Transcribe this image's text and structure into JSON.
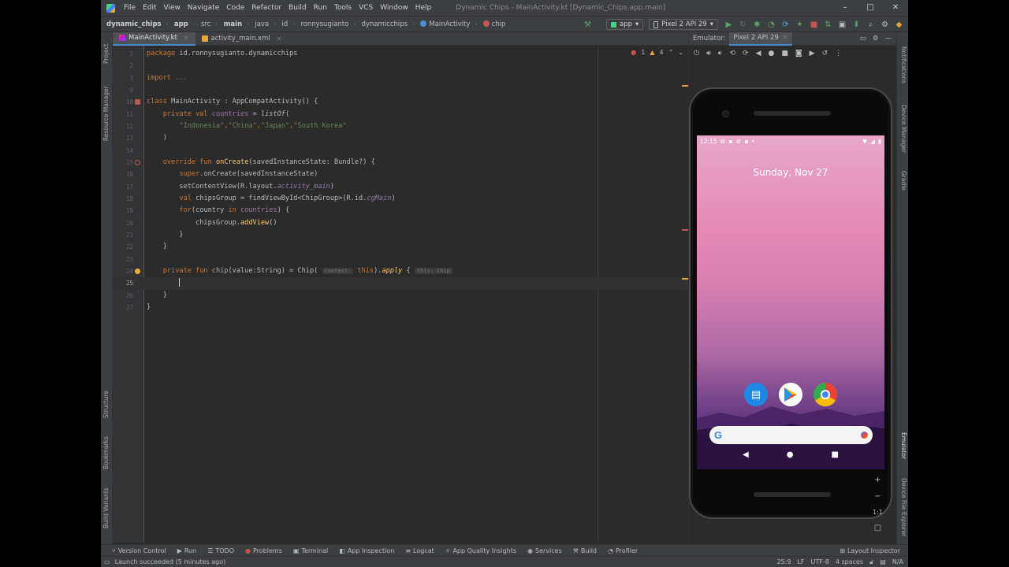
{
  "menubar": {
    "items": [
      "File",
      "Edit",
      "View",
      "Navigate",
      "Code",
      "Refactor",
      "Build",
      "Run",
      "Tools",
      "VCS",
      "Window",
      "Help"
    ],
    "window_title": "Dynamic Chips - MainActivity.kt [Dynamic_Chips.app.main]",
    "minimize": "–",
    "maximize": "□",
    "close": "✕"
  },
  "breadcrumbs": [
    "dynamic_chips",
    "app",
    "src",
    "main",
    "java",
    "id",
    "ronnysugianto",
    "dynamicchips",
    "MainActivity",
    "chip"
  ],
  "toolbar": {
    "config": "app",
    "device": "Pixel 2 API 29"
  },
  "left_tools": [
    "Project",
    "Resource Manager",
    "Structure",
    "Bookmarks",
    "Build Variants"
  ],
  "right_tools": [
    "Notifications",
    "Device Manager",
    "Gradle",
    "Emulator",
    "Device File Explorer"
  ],
  "tabs": [
    {
      "label": "MainActivity.kt",
      "active": true
    },
    {
      "label": "activity_main.xml",
      "active": false
    }
  ],
  "inspection": {
    "errors": "1",
    "warnings": "4"
  },
  "code": {
    "l1": {
      "num": "1",
      "kw": "package",
      "rest": " id.ronnysugianto.dynamicchips"
    },
    "l2": {
      "num": "2"
    },
    "l3": {
      "num": "3",
      "kw": "import",
      "rest": " ..."
    },
    "l9": {
      "num": "9"
    },
    "l10": {
      "num": "10",
      "kw": "class",
      "name": " MainActivity",
      "rest": " : AppCompatActivity() {"
    },
    "l11": {
      "num": "11",
      "kw": "    private val",
      "prop": " countries",
      "rest": " = ",
      "fn": "listOf",
      "rest2": "("
    },
    "l12": {
      "num": "12",
      "s1": "\"Indonesia\"",
      "c1": ",",
      "s2": "\"China\"",
      "c2": ",",
      "s3": "\"Japan\"",
      "c3": ",",
      "s4": "\"South Korea\""
    },
    "l13": {
      "num": "13",
      "rest": "    )"
    },
    "l14": {
      "num": "14"
    },
    "l15": {
      "num": "15",
      "kw": "    override fun",
      "fn": " onCreate",
      "rest": "(savedInstanceState: Bundle?) {"
    },
    "l16": {
      "num": "16",
      "kw": "        super",
      "rest": ".onCreate(savedInstanceState)"
    },
    "l17": {
      "num": "17",
      "rest": "        setContentView(R.layout.",
      "prop": "activity_main",
      "rest2": ")"
    },
    "l18": {
      "num": "18",
      "kw": "        val",
      "rest": " chipsGroup = findViewById<ChipGroup>(R.id.",
      "prop": "cgMain",
      "rest2": ")"
    },
    "l19": {
      "num": "19",
      "kw": "        for",
      "rest": "(country ",
      "kw2": "in",
      "prop": " countries",
      "rest2": ") {"
    },
    "l20": {
      "num": "20",
      "rest": "            chipsGroup.",
      "fn": "addView",
      "rest2": "()"
    },
    "l21": {
      "num": "21",
      "rest": "        }"
    },
    "l22": {
      "num": "22",
      "rest": "    }"
    },
    "l23": {
      "num": "23"
    },
    "l24": {
      "num": "24",
      "kw": "    private fun",
      "fn": " chip",
      "rest": "(value:String) = Chip(",
      "hint1": "context:",
      "kw2": " this",
      "rest2": ").",
      "fn2": "apply",
      "rest3": " { ",
      "hint2": "this: Chip"
    },
    "l25": {
      "num": "25"
    },
    "l26": {
      "num": "26",
      "rest": "    }"
    },
    "l27": {
      "num": "27",
      "rest": "}"
    }
  },
  "emulator": {
    "tab_emulator": "Emulator:",
    "tab_device": "Pixel 2 API 29",
    "status_time": "12:15",
    "date": "Sunday, Nov 27",
    "zoom_plus": "+",
    "zoom_ratio": "1:1"
  },
  "bottom_tools": [
    "Version Control",
    "Run",
    "TODO",
    "Problems",
    "Terminal",
    "App Inspection",
    "Logcat",
    "App Quality Insights",
    "Services",
    "Build",
    "Profiler"
  ],
  "layout_inspector": "Layout Inspector",
  "status": {
    "message": "Launch succeeded (5 minutes ago)",
    "position": "25:9",
    "line_sep": "LF",
    "encoding": "UTF-8",
    "indent": "4 spaces",
    "na": "N/A"
  },
  "colors": {
    "accent": "#4a88c7",
    "keyword": "#cc7832",
    "string": "#6a8759",
    "function": "#ffc66d",
    "property": "#9876aa"
  }
}
